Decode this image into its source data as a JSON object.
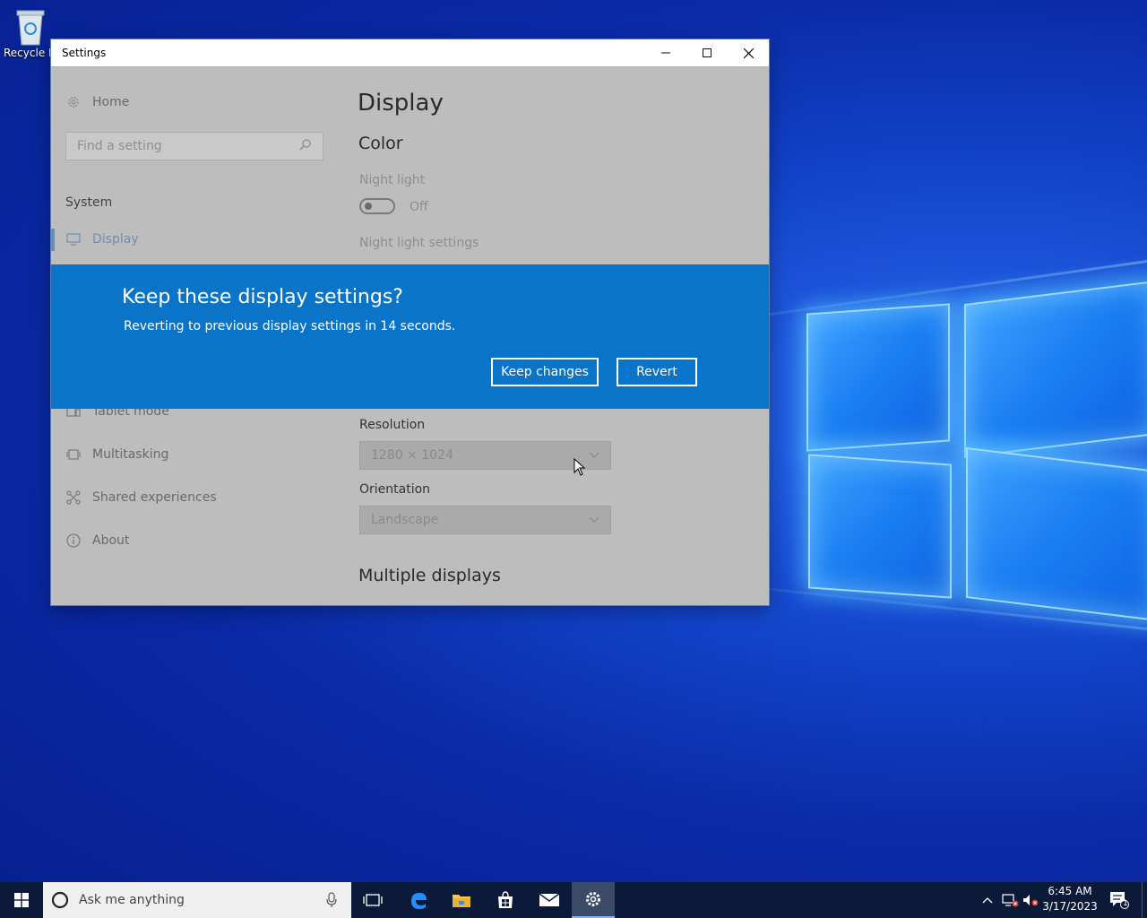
{
  "desktop": {
    "recycle_bin_label": "Recycle Bin"
  },
  "window": {
    "title": "Settings",
    "controls": {
      "minimize": "—",
      "maximize": "☐",
      "close": "✕"
    }
  },
  "sidebar": {
    "home_label": "Home",
    "search_placeholder": "Find a setting",
    "section_label": "System",
    "items": [
      {
        "label": "Display",
        "icon": "monitor-icon",
        "active": true
      },
      {
        "label": "Tablet mode",
        "icon": "tablet-mode-icon"
      },
      {
        "label": "Multitasking",
        "icon": "multitasking-icon"
      },
      {
        "label": "Shared experiences",
        "icon": "shared-experiences-icon"
      },
      {
        "label": "About",
        "icon": "info-icon"
      }
    ]
  },
  "main": {
    "page_title": "Display",
    "color_heading": "Color",
    "night_light_label": "Night light",
    "night_light_state": "Off",
    "night_light_settings_link": "Night light settings",
    "resolution_label": "Resolution",
    "resolution_value": "1280 × 1024",
    "orientation_label": "Orientation",
    "orientation_value": "Landscape",
    "multiple_displays_heading": "Multiple displays"
  },
  "dialog": {
    "title": "Keep these display settings?",
    "message": "Reverting to previous display settings in 14 seconds.",
    "keep_label": "Keep changes",
    "revert_label": "Revert"
  },
  "taskbar": {
    "search_text": "Ask me anything",
    "time": "6:45 AM",
    "date": "3/17/2023",
    "notification_count": "1"
  },
  "colors": {
    "dialog_bg": "#0a74c8",
    "taskbar_bg": "#0c1a3a",
    "accent": "#1a7ef3"
  }
}
